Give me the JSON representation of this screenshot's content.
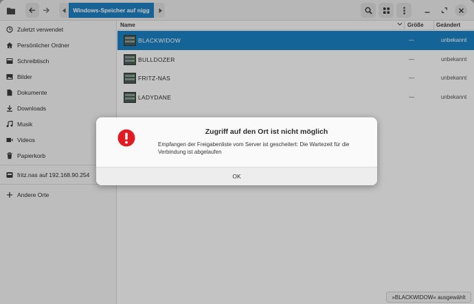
{
  "header": {
    "path_crumb": "Windows-Speicher auf nigg",
    "icons": [
      "folder-icon",
      "back-icon",
      "forward-icon",
      "search-icon",
      "grid-view-icon",
      "menu-icon",
      "minimize-icon",
      "maximize-icon",
      "close-icon"
    ]
  },
  "sidebar": {
    "items": [
      {
        "label": "Zuletzt verwendet",
        "icon": "clock-icon"
      },
      {
        "label": "Persönlicher Ordner",
        "icon": "home-icon"
      },
      {
        "label": "Schreibtisch",
        "icon": "desktop-icon"
      },
      {
        "label": "Bilder",
        "icon": "image-icon"
      },
      {
        "label": "Dokumente",
        "icon": "document-icon"
      },
      {
        "label": "Downloads",
        "icon": "download-icon"
      },
      {
        "label": "Musik",
        "icon": "music-icon"
      },
      {
        "label": "Videos",
        "icon": "video-icon"
      },
      {
        "label": "Papierkorb",
        "icon": "trash-icon"
      },
      {
        "label": "fritz.nas auf 192.168.90.254",
        "icon": "network-drive-icon"
      },
      {
        "label": "Andere Orte",
        "icon": "plus-icon"
      }
    ]
  },
  "columns": {
    "name": "Name",
    "size": "Größe",
    "modified": "Geändert"
  },
  "files": [
    {
      "name": "BLACKWIDOW",
      "size": "—",
      "modified": "unbekannt",
      "selected": true
    },
    {
      "name": "BULLDOZER",
      "size": "—",
      "modified": "unbekannt",
      "selected": false
    },
    {
      "name": "FRITZ-NAS",
      "size": "—",
      "modified": "unbekannt",
      "selected": false
    },
    {
      "name": "LADYDANE",
      "size": "—",
      "modified": "unbekannt",
      "selected": false
    }
  ],
  "statusbar": {
    "text": "»BLACKWIDOW« ausgewählt"
  },
  "dialog": {
    "title": "Zugriff auf den Ort ist nicht möglich",
    "message": "Empfangen der Freigabenliste vom Server ist gescheitert: Die Wartezeit für die Verbindung ist abgelaufen",
    "ok_label": "OK",
    "icon": "error-icon",
    "error_color": "#e01b24"
  },
  "colors": {
    "accent": "#1f7fc0",
    "selection": "#1c80c2"
  }
}
